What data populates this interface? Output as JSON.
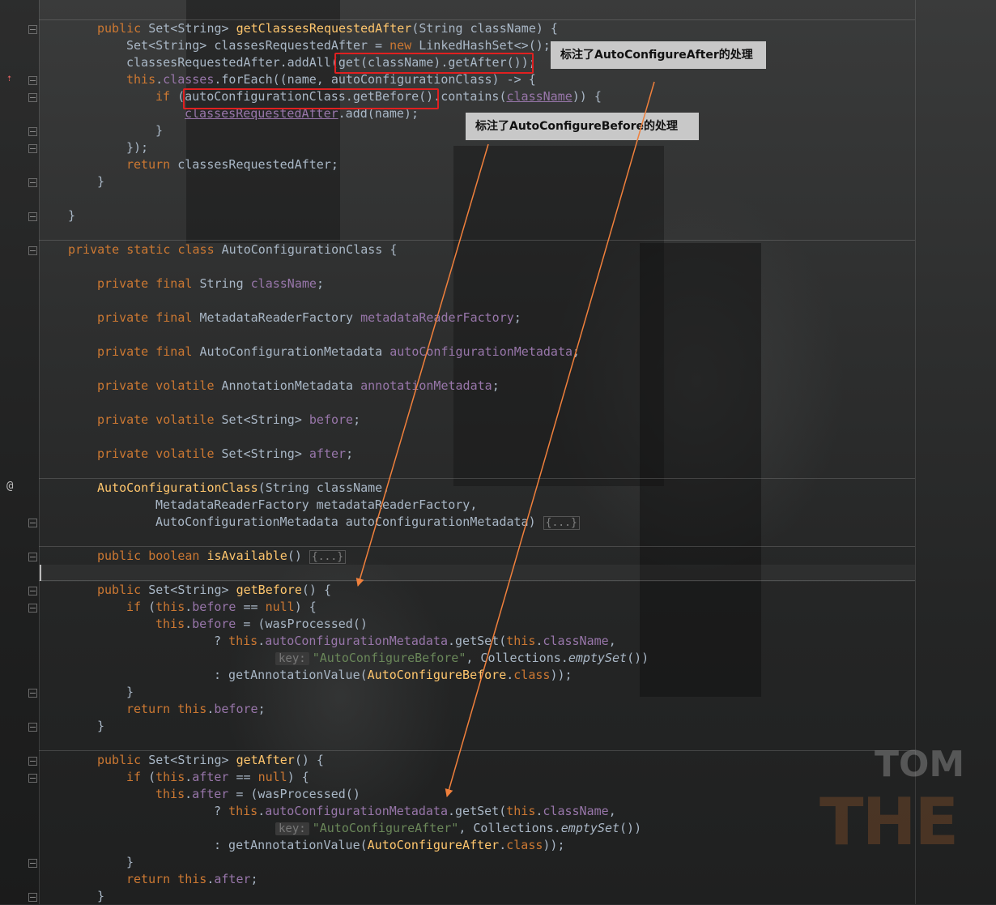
{
  "overlay": {
    "callout_after": "标注了AutoConfigureAfter的处理",
    "callout_before": "标注了AutoConfigureBefore的处理",
    "arrow_color": "#f0803c",
    "box_color": "#e02020"
  },
  "watermark": {
    "line1": "TOM",
    "line2": "THE"
  },
  "gutter": {
    "override_icon": "override-up-icon",
    "annotation_marker": "@"
  },
  "code": {
    "l1": {
      "kw1": "public ",
      "t1": "Set<String> ",
      "fn": "getClassesRequestedAfter",
      "t2": "(String className) {"
    },
    "l2": {
      "t1": "Set<String> classesRequestedAfter = ",
      "kw": "new ",
      "t2": "LinkedHashSet<>();"
    },
    "l3": {
      "t1": "classesRequestedAfter.addAll(",
      "t2": "get(className).getAfter()",
      "t3": ");"
    },
    "l4": {
      "kw": "this",
      "t1": ".",
      "fd": "classes",
      "t2": ".forEach((name, autoConfigurationClass) -> {"
    },
    "l5": {
      "kw": "if ",
      "t1": "(",
      "t2": "autoConfigurationClass.getBefore()",
      "t3": ".contains(",
      "fd": "className",
      "t4": ")) {"
    },
    "l6": {
      "fd": "classesRequestedAfter",
      "t1": ".add(name);"
    },
    "l7": "}",
    "l8": "});",
    "l9": {
      "kw": "return ",
      "t1": "classesRequestedAfter;"
    },
    "l10": "}",
    "l12": "}",
    "l14": {
      "kw": "private static class ",
      "t1": "AutoConfigurationClass {"
    },
    "f1": {
      "kw": "private final ",
      "t1": "String ",
      "fd": "className",
      "t2": ";"
    },
    "f2": {
      "kw": "private final ",
      "t1": "MetadataReaderFactory ",
      "fd": "metadataReaderFactory",
      "t2": ";"
    },
    "f3": {
      "kw": "private final ",
      "t1": "AutoConfigurationMetadata ",
      "fd": "autoConfigurationMetadata",
      "t2": ";"
    },
    "f4": {
      "kw": "private volatile ",
      "t1": "AnnotationMetadata ",
      "fd": "annotationMetadata",
      "t2": ";"
    },
    "f5": {
      "kw": "private volatile ",
      "t1": "Set<String> ",
      "fd": "before",
      "t2": ";"
    },
    "f6": {
      "kw": "private volatile ",
      "t1": "Set<String> ",
      "fd": "after",
      "t2": ";"
    },
    "c1": {
      "fn": "AutoConfigurationClass",
      "t1": "(String className,"
    },
    "c2": {
      "t1": "MetadataReaderFactory metadataReaderFactory,"
    },
    "c3": {
      "t1": "AutoConfigurationMetadata autoConfigurationMetadata) ",
      "fold": "{...}"
    },
    "m1": {
      "kw": "public boolean ",
      "fn": "isAvailable",
      "t1": "() ",
      "fold": "{...}"
    },
    "gb": {
      "sig": {
        "kw": "public ",
        "t1": "Set<String> ",
        "fn": "getBefore",
        "t2": "() {"
      },
      "if": {
        "kw": "if ",
        "t1": "(",
        "kw2": "this",
        "t2": ".",
        "fd": "before",
        "t3": " == ",
        "kw3": "null",
        "t4": ") {"
      },
      "assign": {
        "kw": "this",
        "t1": ".",
        "fd": "before",
        "t2": " = (wasProcessed()"
      },
      "q": {
        "t1": "? ",
        "kw": "this",
        "t2": ".",
        "fd": "autoConfigurationMetadata",
        "t3": ".getSet(",
        "kw2": "this",
        "t4": ".",
        "fd2": "className",
        "t5": ","
      },
      "key": {
        "hint": "key:",
        "st": "\"AutoConfigureBefore\"",
        "t1": ", Collections.",
        "it": "emptySet",
        "t2": "())"
      },
      "colon": {
        "t1": ": getAnnotationValue(",
        "fn": "AutoConfigureBefore",
        "t2": ".",
        "kw": "class",
        "t3": "));"
      },
      "close1": "}",
      "ret": {
        "kw": "return ",
        "kw2": "this",
        "t1": ".",
        "fd": "before",
        "t2": ";"
      },
      "close2": "}"
    },
    "ga": {
      "sig": {
        "kw": "public ",
        "t1": "Set<String> ",
        "fn": "getAfter",
        "t2": "() {"
      },
      "if": {
        "kw": "if ",
        "t1": "(",
        "kw2": "this",
        "t2": ".",
        "fd": "after",
        "t3": " == ",
        "kw3": "null",
        "t4": ") {"
      },
      "assign": {
        "kw": "this",
        "t1": ".",
        "fd": "after",
        "t2": " = (wasProcessed()"
      },
      "q": {
        "t1": "? ",
        "kw": "this",
        "t2": ".",
        "fd": "autoConfigurationMetadata",
        "t3": ".getSet(",
        "kw2": "this",
        "t4": ".",
        "fd2": "className",
        "t5": ","
      },
      "key": {
        "hint": "key:",
        "st": "\"AutoConfigureAfter\"",
        "t1": ", Collections.",
        "it": "emptySet",
        "t2": "())"
      },
      "colon": {
        "t1": ": getAnnotationValue(",
        "fn": "AutoConfigureAfter",
        "t2": ".",
        "kw": "class",
        "t3": "));"
      },
      "close1": "}",
      "ret": {
        "kw": "return ",
        "kw2": "this",
        "t1": ".",
        "fd": "after",
        "t2": ";"
      },
      "close2": "}"
    }
  }
}
